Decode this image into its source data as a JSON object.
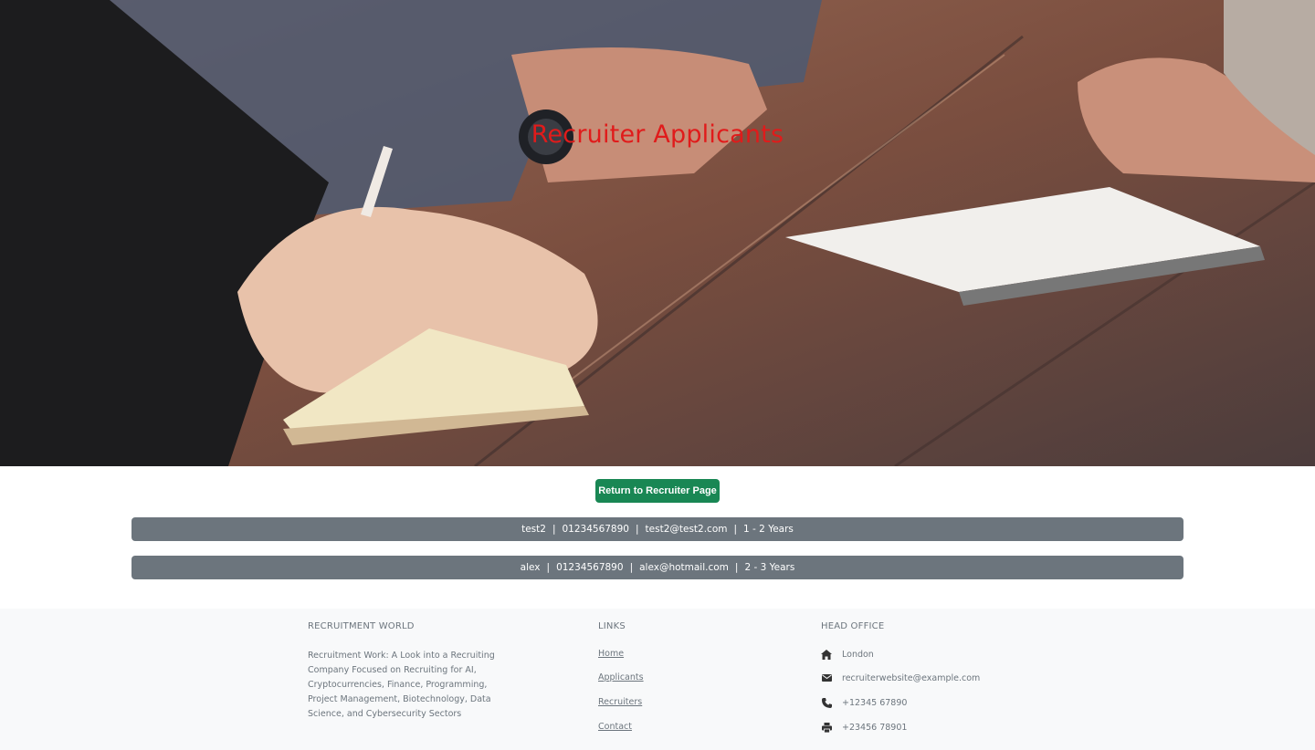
{
  "hero": {
    "title": "Recruiter Applicants"
  },
  "return_button": {
    "label": "Return to Recruiter Page",
    "color": "#198754"
  },
  "applicants": [
    {
      "name": "test2",
      "phone": "01234567890",
      "email": "test2@test2.com",
      "experience": "1 - 2 Years"
    },
    {
      "name": "alex",
      "phone": "01234567890",
      "email": "alex@hotmail.com",
      "experience": "2 - 3 Years"
    }
  ],
  "footer": {
    "about": {
      "heading": "RECRUITMENT WORLD",
      "text": "Recruitment Work: A Look into a Recruiting Company Focused on Recruiting for AI, Cryptocurrencies, Finance, Programming, Project Management, Biotechnology, Data Science, and Cybersecurity Sectors"
    },
    "links": {
      "heading": "LINKS",
      "items": [
        "Home",
        "Applicants",
        "Recruiters",
        "Contact"
      ]
    },
    "office": {
      "heading": "HEAD OFFICE",
      "items": [
        {
          "icon": "home-icon",
          "text": "London"
        },
        {
          "icon": "envelope-icon",
          "text": "recruiterwebsite@example.com"
        },
        {
          "icon": "phone-icon",
          "text": "+12345 67890"
        },
        {
          "icon": "printer-icon",
          "text": "+23456 78901"
        }
      ]
    }
  }
}
